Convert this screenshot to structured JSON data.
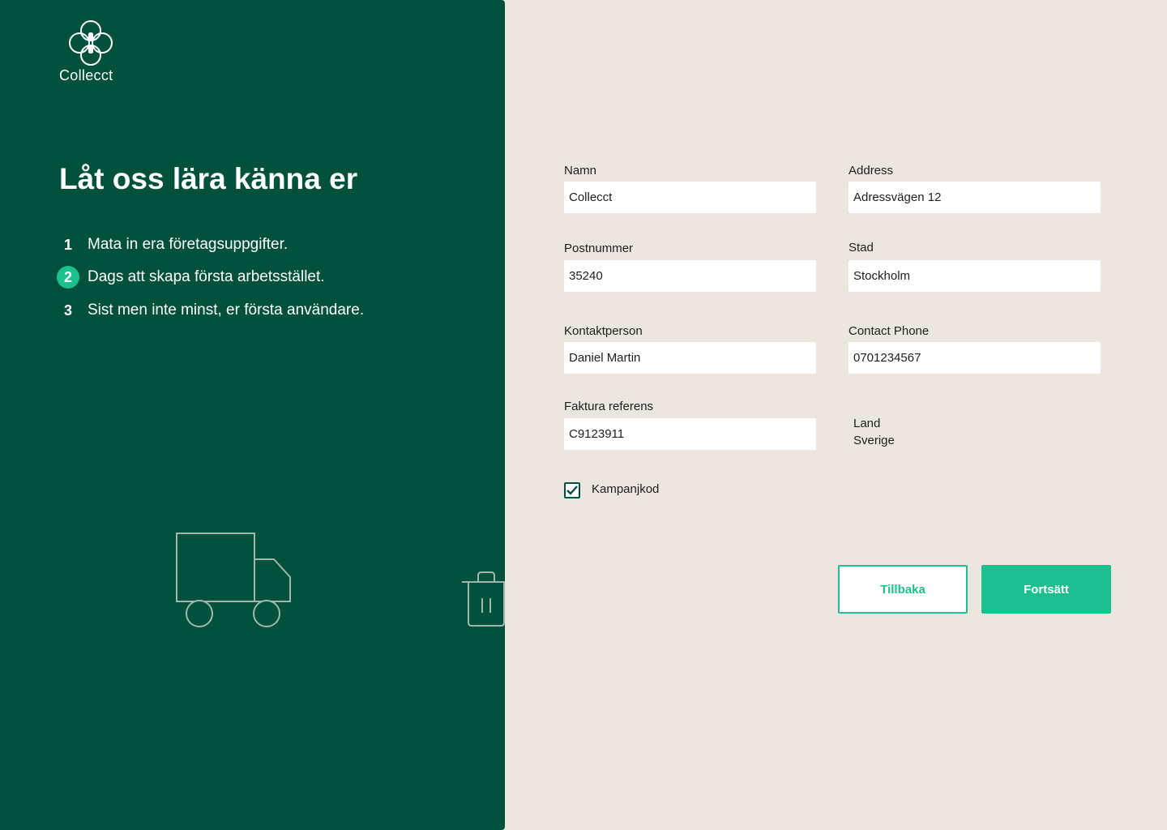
{
  "brand": {
    "name": "Collecct",
    "logo_icon": "four-circle-logo-icon"
  },
  "sidebar": {
    "headline": "Låt oss lära känna er",
    "steps": [
      {
        "number": "1",
        "text": "Mata in era företagsuppgifter.",
        "active": false
      },
      {
        "number": "2",
        "text": "Dags att skapa första arbetsstället.",
        "active": true
      },
      {
        "number": "3",
        "text": "Sist men inte minst, er första användare.",
        "active": false
      }
    ],
    "illustrations": [
      "truck-icon",
      "trash-bin-icon"
    ]
  },
  "form": {
    "name": {
      "label": "Namn",
      "value": "Collecct"
    },
    "address": {
      "label": "Address",
      "value": "Adressvägen 12"
    },
    "postal_code": {
      "label": "Postnummer",
      "value": "35240"
    },
    "city": {
      "label": "Stad",
      "value": "Stockholm"
    },
    "contact_person": {
      "label": "Kontaktperson",
      "value": "Daniel Martin"
    },
    "contact_phone": {
      "label": "Contact Phone",
      "value": "0701234567"
    },
    "invoice_reference": {
      "label": "Faktura referens",
      "value": "C9123911"
    },
    "country": {
      "label": "Land",
      "value": "Sverige"
    },
    "campaign_code": {
      "label": "Kampanjkod",
      "checked": true
    }
  },
  "actions": {
    "back_label": "Tillbaka",
    "next_label": "Fortsätt"
  },
  "colors": {
    "sidebar_bg": "#00513C",
    "page_bg": "#ECE6E0",
    "accent": "#1CC08E",
    "text_dark": "#1E1E1E"
  }
}
